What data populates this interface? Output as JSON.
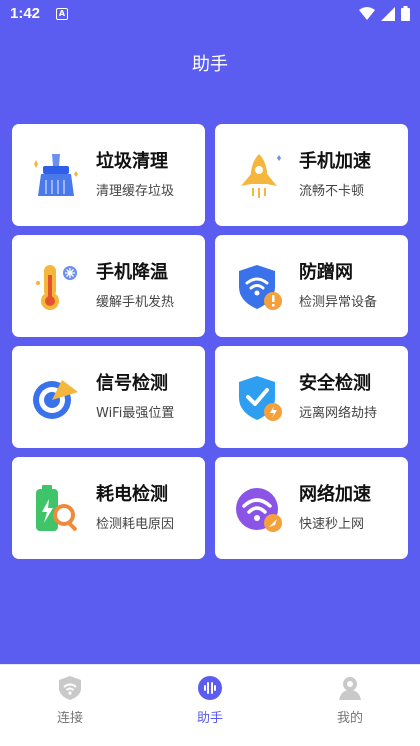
{
  "status": {
    "time": "1:42",
    "a_badge": "A"
  },
  "header": {
    "title": "助手"
  },
  "cards": [
    {
      "title": "垃圾清理",
      "subtitle": "清理缓存垃圾",
      "icon": "broom-icon"
    },
    {
      "title": "手机加速",
      "subtitle": "流畅不卡顿",
      "icon": "rocket-icon"
    },
    {
      "title": "手机降温",
      "subtitle": "缓解手机发热",
      "icon": "thermometer-icon"
    },
    {
      "title": "防蹭网",
      "subtitle": "检测异常设备",
      "icon": "wifi-shield-icon"
    },
    {
      "title": "信号检测",
      "subtitle": "WiFi最强位置",
      "icon": "signal-radar-icon"
    },
    {
      "title": "安全检测",
      "subtitle": "远离网络劫持",
      "icon": "security-shield-icon"
    },
    {
      "title": "耗电检测",
      "subtitle": "检测耗电原因",
      "icon": "battery-search-icon"
    },
    {
      "title": "网络加速",
      "subtitle": "快速秒上网",
      "icon": "wifi-rocket-icon"
    }
  ],
  "tabs": [
    {
      "label": "连接",
      "icon": "shield-wifi-icon",
      "active": false
    },
    {
      "label": "助手",
      "icon": "assistant-voice-icon",
      "active": true
    },
    {
      "label": "我的",
      "icon": "profile-icon",
      "active": false
    }
  ],
  "colors": {
    "accent": "#5b5cf0",
    "card": "#ffffff"
  }
}
